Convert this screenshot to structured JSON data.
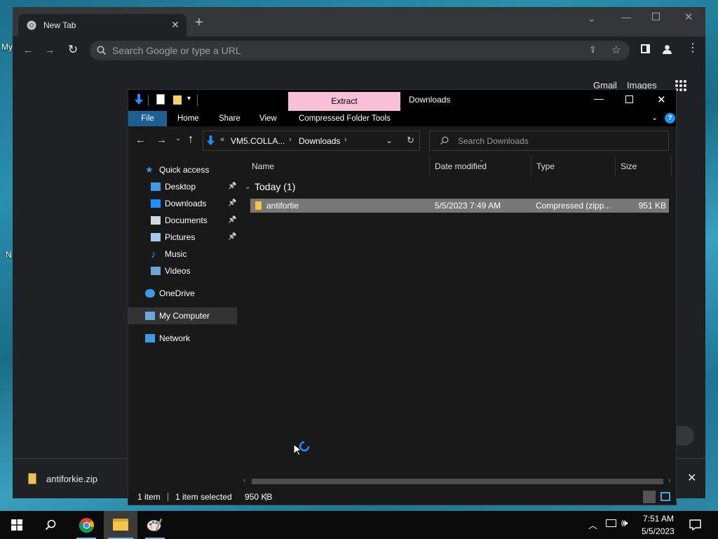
{
  "desktop": {
    "fragments": [
      "My",
      "N"
    ]
  },
  "chrome": {
    "tab_title": "New Tab",
    "omnibox_placeholder": "Search Google or type a URL",
    "ntp_links": [
      "Gmail",
      "Images"
    ],
    "download": {
      "filename": "antiforkie.zip"
    }
  },
  "explorer": {
    "title": "Downloads",
    "contextual_tab": "Extract",
    "ribbon_tabs": [
      "File",
      "Home",
      "Share",
      "View",
      "Compressed Folder Tools"
    ],
    "address": {
      "prefix": "«",
      "segment1": "VM5.COLLA...",
      "segment2": "Downloads"
    },
    "search_placeholder": "Search Downloads",
    "nav": [
      {
        "label": "Quick access",
        "icon": "star-icon",
        "top": true,
        "pinned": false
      },
      {
        "label": "Desktop",
        "icon": "desktop-icon",
        "top": false,
        "pinned": true
      },
      {
        "label": "Downloads",
        "icon": "download-arrow-icon",
        "top": false,
        "pinned": true
      },
      {
        "label": "Documents",
        "icon": "document-icon",
        "top": false,
        "pinned": true
      },
      {
        "label": "Pictures",
        "icon": "pictures-icon",
        "top": false,
        "pinned": true
      },
      {
        "label": "Music",
        "icon": "music-icon",
        "top": false,
        "pinned": false
      },
      {
        "label": "Videos",
        "icon": "videos-icon",
        "top": false,
        "pinned": false
      },
      {
        "label": "OneDrive",
        "icon": "cloud-icon",
        "top": true,
        "pinned": false
      },
      {
        "label": "My Computer",
        "icon": "computer-icon",
        "top": true,
        "pinned": false
      },
      {
        "label": "Network",
        "icon": "network-icon",
        "top": true,
        "pinned": false
      }
    ],
    "columns": [
      "Name",
      "Date modified",
      "Type",
      "Size"
    ],
    "group": "Today (1)",
    "file": {
      "name": "antifortie",
      "date": "5/5/2023 7:49 AM",
      "type": "Compressed (zipp...",
      "size": "951 KB"
    },
    "status": {
      "count": "1 item",
      "selected": "1 item selected",
      "size": "950 KB"
    }
  },
  "taskbar": {
    "time": "7:51 AM",
    "date": "5/5/2023"
  },
  "colors": {
    "extract_tab": "#f8bfd8",
    "file_tab": "#1e5f91",
    "accent_blue": "#1e90ff"
  }
}
